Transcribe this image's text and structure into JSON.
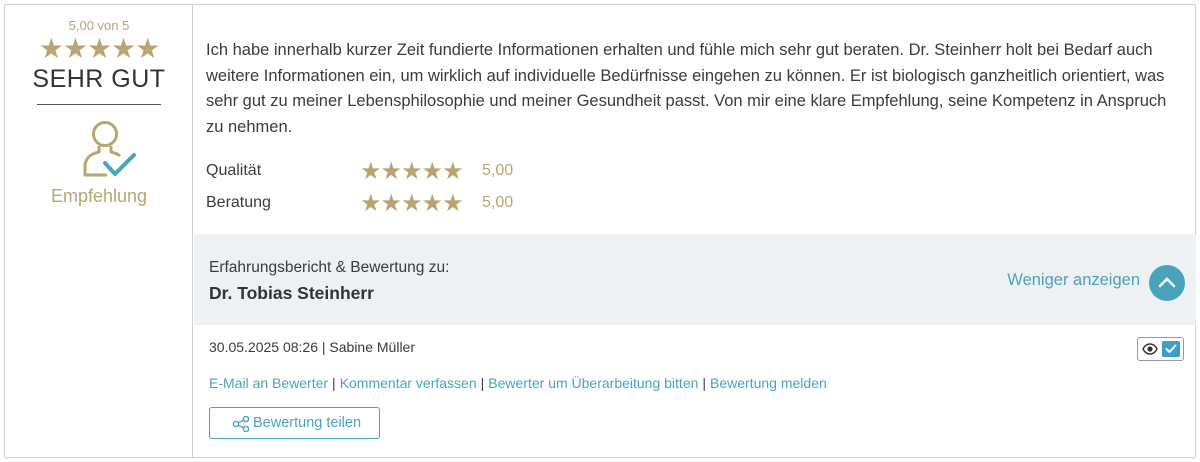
{
  "summary": {
    "score_text": "5,00 von 5",
    "score": 5.0,
    "stars": "★★★★★",
    "verdict": "SEHR GUT",
    "recommendation_label": "Empfehlung"
  },
  "review": {
    "text": "Ich habe innerhalb kurzer Zeit fundierte Informationen erhalten und fühle mich sehr gut beraten. Dr. Steinherr holt bei Bedarf auch weitere Informationen ein, um wirklich auf individuelle Bedürfnisse eingehen zu können. Er ist biologisch ganzheitlich orientiert, was sehr gut zu meiner Lebensphilosophie und meiner Gesundheit passt. Von mir eine klare Empfehlung, seine Kompetenz in Anspruch zu nehmen.",
    "ratings": [
      {
        "label": "Qualität",
        "stars": "★★★★★",
        "value": "5,00"
      },
      {
        "label": "Beratung",
        "stars": "★★★★★",
        "value": "5,00"
      }
    ]
  },
  "about": {
    "label": "Erfahrungsbericht & Bewertung zu:",
    "doctor": "Dr. Tobias Steinherr",
    "toggle_label": "Weniger anzeigen"
  },
  "meta": {
    "date_author": "30.05.2025 08:26 | Sabine Müller"
  },
  "actions": {
    "links": [
      "E-Mail an Bewerter",
      "Kommentar verfassen",
      "Bewerter um Überarbeitung bitten",
      "Bewertung melden"
    ],
    "separator": "|",
    "share_label": "Bewertung teilen"
  },
  "colors": {
    "gold": "#b9a571",
    "accent": "#4aa3bd",
    "band": "#eef1f3"
  }
}
